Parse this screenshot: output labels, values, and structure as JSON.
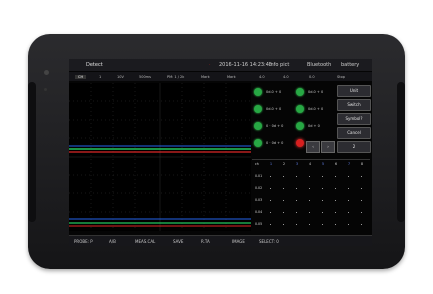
{
  "titlebar": {
    "mode": "Detect",
    "mid_marker": "·",
    "datetime": "2016-11-16 14:23:45",
    "info": "Info pict",
    "bluetooth": "Bluetooth",
    "battery": "battery"
  },
  "statusbar": {
    "items": [
      "CH",
      "1",
      "10V",
      "500ms",
      "PM: 1 / 2k",
      "Mark",
      "Mark",
      "4.0",
      "4.0",
      "0.0",
      "Stop"
    ]
  },
  "indicators": [
    {
      "color": "#27a844",
      "label": "0d.0 + 0"
    },
    {
      "color": "#27a844",
      "label": "0d.0 + 0"
    },
    {
      "color": "#27a844",
      "label": "0d.0 + 0"
    },
    {
      "color": "#27a844",
      "label": "0d.0 + 0"
    },
    {
      "color": "#27a844",
      "label": "0 · 0d + 0"
    },
    {
      "color": "#27a844",
      "label": "0d + 0"
    },
    {
      "color": "#27a844",
      "label": "0 · 0d + 0"
    },
    {
      "color": "#d81f1f",
      "label": "0d + 0"
    }
  ],
  "buttons": [
    "Unit",
    "Switch",
    "Symbol?",
    "Cancel",
    "2"
  ],
  "small_buttons": [
    "‹",
    "›"
  ],
  "grid": {
    "col_headers": [
      "ch",
      "1",
      "2",
      "3",
      "4",
      "5",
      "6",
      "7",
      "8"
    ],
    "row_labels": [
      "0.01",
      "0.02",
      "0.03",
      "0.04",
      "0.05"
    ]
  },
  "bottombar": {
    "items": [
      "PROBE: P",
      "A/B",
      "MEAS.CAL",
      "SAVE",
      "R.TA",
      "IMAGE",
      "SELECT: 0"
    ]
  },
  "colors": {
    "accent": "#27a844",
    "alert": "#d81f1f",
    "trace_green": "#22c55e",
    "trace_red": "#dc2626",
    "trace_blue": "#2563eb"
  }
}
